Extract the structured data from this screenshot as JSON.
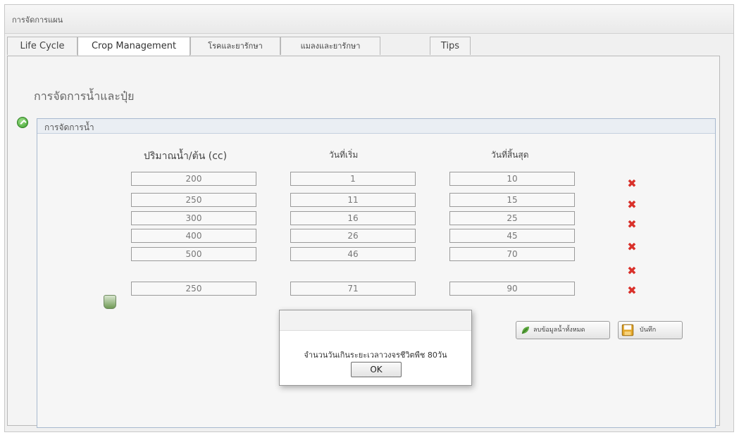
{
  "window": {
    "title": "การจัดการแผน"
  },
  "tabs": [
    {
      "label": "Life Cycle",
      "active": false
    },
    {
      "label": "Crop Management",
      "active": true
    },
    {
      "label": "โรคและยารักษา",
      "active": false
    },
    {
      "label": "แมลงและยารักษา",
      "active": false
    },
    {
      "label": "Tips",
      "active": false
    }
  ],
  "section": {
    "title": "การจัดการน้ำและปุ๋ย"
  },
  "group": {
    "title": "การจัดการน้ำ"
  },
  "columns": {
    "amount": "ปริมาณน้ำ/ต้น (cc)",
    "start": "วันที่เริ่ม",
    "end": "วันที่สิ้นสุด"
  },
  "rows": [
    {
      "amount": "200",
      "start": "1",
      "end": "10"
    },
    {
      "amount": "250",
      "start": "11",
      "end": "15"
    },
    {
      "amount": "300",
      "start": "16",
      "end": "25"
    },
    {
      "amount": "400",
      "start": "26",
      "end": "45"
    },
    {
      "amount": "500",
      "start": "46",
      "end": "70"
    },
    {
      "amount": "250",
      "start": "71",
      "end": "90"
    }
  ],
  "buttons": {
    "clear_all": "ลบข้อมูลน้ำทั้งหมด",
    "save": "บันทึก"
  },
  "dialog": {
    "message": "จำนวนวันเกินระยะเวลาวงจรชีวิตพืช 80วัน",
    "ok": "OK"
  },
  "icons": {
    "toggle": "green-expand-icon",
    "delete": "red-x-icon",
    "add": "water-bucket-icon",
    "clear": "leaf-icon",
    "save": "floppy-disk-icon"
  },
  "colors": {
    "delete": "#d9302a",
    "accent_green": "#3a9e2a"
  }
}
